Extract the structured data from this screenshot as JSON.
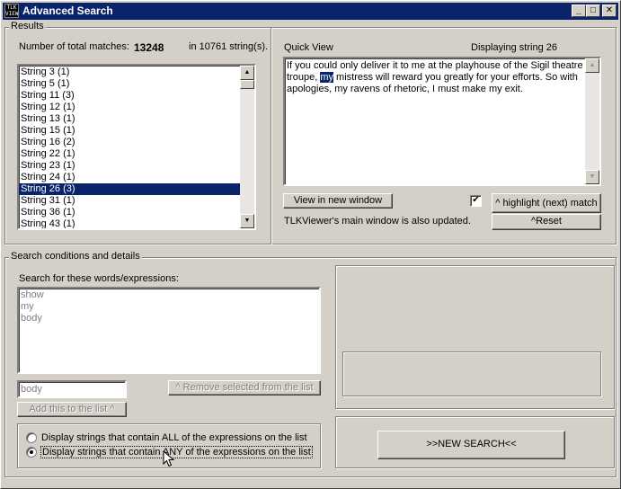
{
  "window": {
    "title": "Advanced Search",
    "icon_text": "TLK VIEW",
    "minimize": "_",
    "maximize": "□",
    "close": "✕"
  },
  "results": {
    "group_title": "Results",
    "matches_label": "Number of total matches:",
    "matches_count": "13248",
    "strings_info": "in 10761 string(s).",
    "list": [
      "String 3 (1)",
      "String 5 (1)",
      "String 11 (3)",
      "String 12 (1)",
      "String 13 (1)",
      "String 15 (1)",
      "String 16 (2)",
      "String 22 (1)",
      "String 23 (1)",
      "String 24 (1)",
      "String 26 (3)",
      "String 31 (1)",
      "String 36 (1)",
      "String 43 (1)"
    ],
    "selected_index": 10
  },
  "quickview": {
    "label": "Quick View",
    "displaying": "Displaying string 26",
    "text_before": "If you could only deliver it to me at the playhouse of the Sigil theatre troupe, ",
    "text_highlight": "my",
    "text_after": " mistress will reward you greatly for your efforts. So with apologies, my ravens of rhetoric, I must make my exit.",
    "view_button": "View in new window",
    "check_mark": "✔",
    "highlight_button": "^ highlight (next) match",
    "reset_button": "^Reset",
    "main_updated": "TLKViewer's main window is also updated."
  },
  "conditions": {
    "group_title": "Search conditions and details",
    "search_label": "Search for these words/expressions:",
    "expressions": [
      "show",
      "my",
      "body"
    ],
    "input_value": "body",
    "remove_button": "^ Remove selected from the list",
    "add_button": "Add this to the list ^",
    "option_all": "Display strings that contain ALL of the expressions on the list",
    "option_any": "Display strings that contain ANY of the expressions on the list",
    "selected_option": "any",
    "new_search_button": ">>NEW SEARCH<<"
  },
  "icons": {
    "scroll_up": "▲",
    "scroll_down": "▼"
  }
}
